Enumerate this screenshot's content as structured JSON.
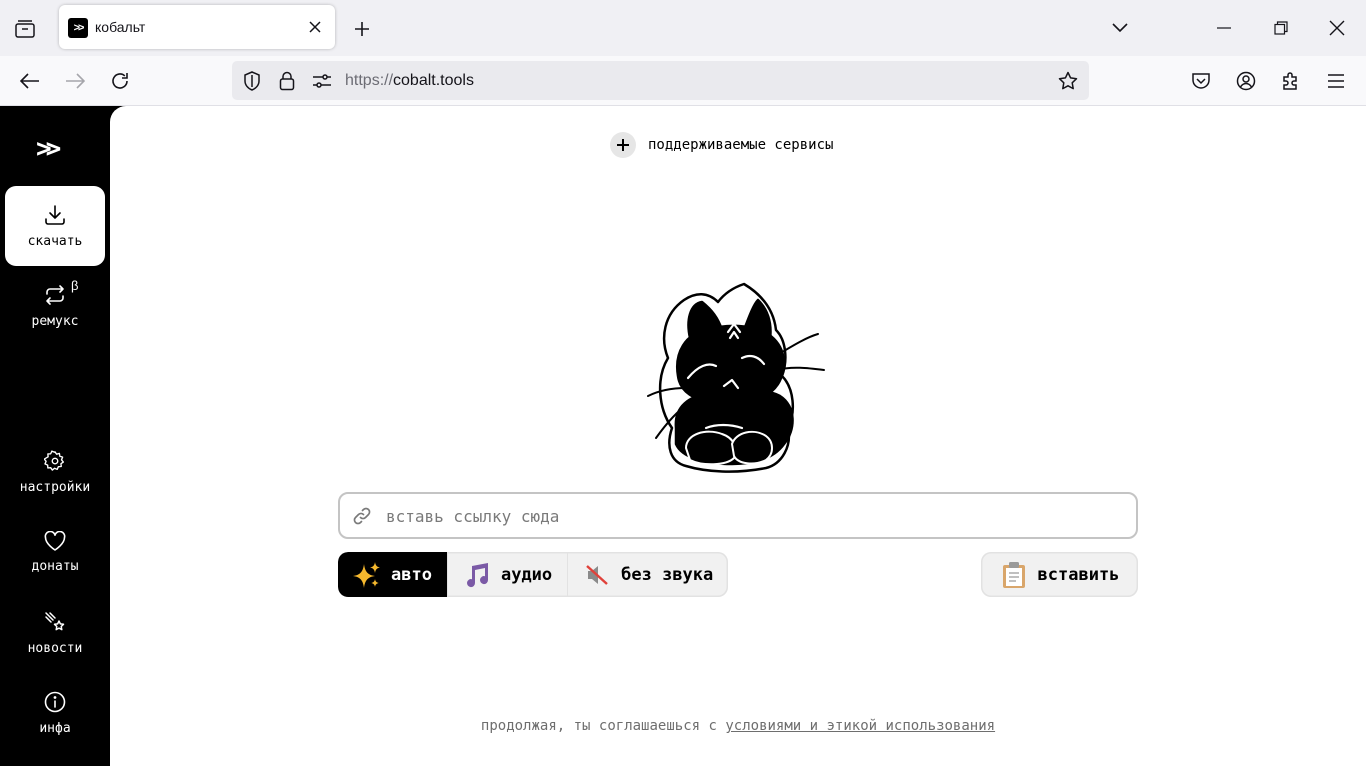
{
  "browser": {
    "tab": {
      "title": "кобальт"
    },
    "url": {
      "protocol": "https://",
      "host": "cobalt.tools"
    },
    "icons": [
      "tab-list-icon",
      "close-icon",
      "plus-icon",
      "chevron-down-icon",
      "minimize-icon",
      "restore-icon",
      "close-window-icon",
      "back-icon",
      "forward-icon",
      "reload-icon",
      "shield-icon",
      "lock-icon",
      "permissions-icon",
      "bookmark-star-icon",
      "pocket-icon",
      "account-icon",
      "extensions-icon",
      "menu-icon"
    ]
  },
  "sidebar": {
    "logo": ">>",
    "items": [
      {
        "label": "скачать",
        "icon": "download-icon",
        "active": true
      },
      {
        "label": "ремукс",
        "icon": "remux-icon",
        "badge": "β"
      },
      {
        "label": "настройки",
        "icon": "gear-icon"
      },
      {
        "label": "донаты",
        "icon": "heart-icon"
      },
      {
        "label": "новости",
        "icon": "comet-icon"
      },
      {
        "label": "инфа",
        "icon": "info-icon"
      }
    ]
  },
  "main": {
    "services_label": "поддерживаемые сервисы",
    "input_placeholder": "вставь ссылку сюда",
    "modes": [
      {
        "label": "авто",
        "icon": "sparkles-icon",
        "active": true
      },
      {
        "label": "аудио",
        "icon": "music-notes-icon"
      },
      {
        "label": "без звука",
        "icon": "muted-icon"
      }
    ],
    "paste_label": "вставить",
    "footer_text": "продолжая, ты соглашаешься с",
    "footer_link": "условиями и этикой использования"
  },
  "colors": {
    "sidebar_bg": "#000000",
    "main_bg": "#ffffff",
    "sparkle": "#f5b82e",
    "music": "#7b5aa6"
  }
}
